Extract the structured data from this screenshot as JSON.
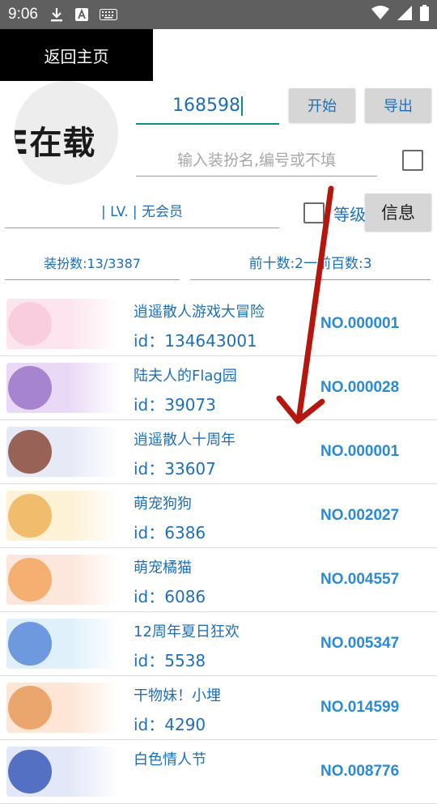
{
  "status_bar": {
    "time": "9:06",
    "icons": [
      "download-icon",
      "font-icon",
      "keyboard-icon",
      "wifi-icon",
      "signal-icon",
      "battery-icon"
    ]
  },
  "back_button": "返回主页",
  "avatar_text": "E在载",
  "id_input": {
    "value": "168598"
  },
  "buttons": {
    "start": "开始",
    "export": "导出",
    "info": "信息"
  },
  "search": {
    "placeholder": "输入装扮名,编号或不填"
  },
  "level_text": "| LV. | 无会员",
  "level_checkbox_label": "等级",
  "counts": {
    "outfits": "装扮数:13/3387",
    "tops": "前十数:2一前百数:3"
  },
  "colors": {
    "accent": "#1f6fb6",
    "arrow": "#b5170f",
    "underline": "#138a8a"
  },
  "items": [
    {
      "name": "逍遥散人游戏大冒险",
      "id": "id：134643001",
      "no": "NO.000001",
      "thumb": "#fde4ee",
      "fig": "#f8c9da"
    },
    {
      "name": "陆夫人的Flag园",
      "id": "id：39073",
      "no": "NO.000028",
      "thumb": "#ead9f6",
      "fig": "#9a76c7"
    },
    {
      "name": "逍遥散人十周年",
      "id": "id：33607",
      "no": "NO.000001",
      "thumb": "#e6eaf7",
      "fig": "#8a4a3a"
    },
    {
      "name": "萌宠狗狗",
      "id": "id：6386",
      "no": "NO.002027",
      "thumb": "#fdf1d6",
      "fig": "#f0b35a"
    },
    {
      "name": "萌宠橘猫",
      "id": "id：6086",
      "no": "NO.004557",
      "thumb": "#fde6dc",
      "fig": "#f2a55e"
    },
    {
      "name": "12周年夏日狂欢",
      "id": "id：5538",
      "no": "NO.005347",
      "thumb": "#dff0fb",
      "fig": "#5a8ad8"
    },
    {
      "name": "干物妹！小埋",
      "id": "id：4290",
      "no": "NO.014599",
      "thumb": "#fde6d6",
      "fig": "#e79a5a"
    },
    {
      "name": "白色情人节",
      "id": "",
      "no": "NO.008776",
      "thumb": "#e3e8f8",
      "fig": "#3a5ab8"
    }
  ]
}
